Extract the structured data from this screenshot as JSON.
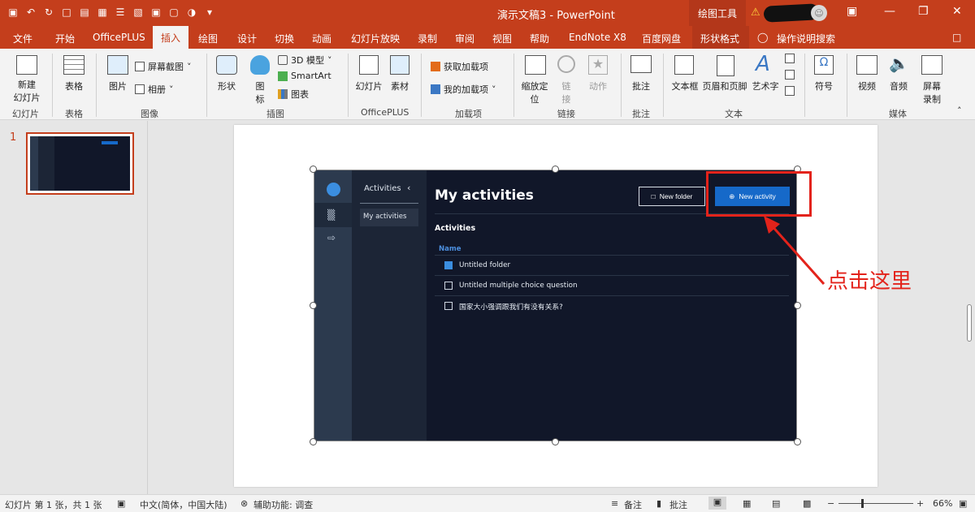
{
  "titlebar": {
    "title": "演示文稿3 - PowerPoint",
    "drawing_tools": "绘图工具",
    "icons": [
      "save-icon",
      "undo-icon",
      "redo-icon",
      "format-painter-icon",
      "paste-icon",
      "shapes-icon",
      "align-icon",
      "distribute-icon",
      "group-icon",
      "crop-icon",
      "lock-icon",
      "dropdown-icon"
    ]
  },
  "menu": {
    "tabs": [
      "文件",
      "开始",
      "OfficePLUS",
      "插入",
      "绘图",
      "设计",
      "切换",
      "动画",
      "幻灯片放映",
      "录制",
      "审阅",
      "视图",
      "帮助",
      "EndNote X8",
      "百度网盘",
      "形状格式"
    ],
    "active_tab": "插入",
    "search": "操作说明搜索"
  },
  "ribbon": {
    "new_slide": "新建\n幻灯片",
    "new_slide_1": "新建",
    "new_slide_2": "幻灯片",
    "group_slides": "幻灯片",
    "table": "表格",
    "group_table": "表格",
    "picture": "图片",
    "screenshot": "屏幕截图",
    "album": "相册",
    "group_image": "图像",
    "shapes": "形状",
    "icons": "图\n标",
    "icons_1": "图",
    "icons_2": "标",
    "model3d": "3D 模型",
    "smartart": "SmartArt",
    "chart": "图表",
    "group_illust": "插图",
    "slide_lib": "幻灯片",
    "material": "素材",
    "group_officeplus": "OfficePLUS",
    "get_addins": "获取加载项",
    "my_addins": "我的加载项",
    "group_addins": "加载项",
    "zoom": "缩放定\n位",
    "zoom_1": "缩放定",
    "zoom_2": "位",
    "link": "链\n接",
    "link_1": "链",
    "link_2": "接",
    "action": "动作",
    "group_links": "链接",
    "comment": "批注",
    "group_comments": "批注",
    "textbox": "文本框",
    "header_footer": "页眉和页脚",
    "wordart": "艺术字",
    "group_text": "文本",
    "symbol": "符号",
    "video": "视频",
    "audio": "音频",
    "screen_record": "屏幕\n录制",
    "screen_record_1": "屏幕",
    "screen_record_2": "录制",
    "group_media": "媒体"
  },
  "thumbs": {
    "slide_number": "1"
  },
  "app": {
    "panel_title": "Activities",
    "panel_item": "My activities",
    "page_title": "My activities",
    "new_folder": "New folder",
    "new_activity": "New activity",
    "section": "Activities",
    "col_name": "Name",
    "rows": [
      {
        "label": "Untitled folder",
        "icon": "folder-icon"
      },
      {
        "label": "Untitled multiple choice question",
        "icon": "question-icon"
      },
      {
        "label": "国家大小强调跟我们有没有关系?",
        "icon": "question-icon"
      }
    ]
  },
  "callout": {
    "text": "点击这里",
    "color": "#e3231b"
  },
  "statusbar": {
    "slide_info": "幻灯片 第 1 张，共 1 张",
    "language": "中文(简体，中国大陆)",
    "accessibility": "辅助功能: 调查",
    "notes": "备注",
    "comments": "批注",
    "zoom": "66%"
  },
  "colors": {
    "accent": "#c43e1c",
    "app_bg": "#111729",
    "button_blue": "#1669c9"
  }
}
